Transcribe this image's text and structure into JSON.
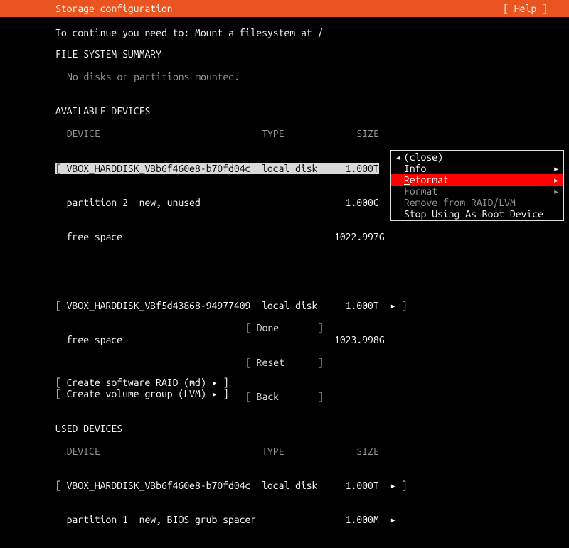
{
  "header": {
    "title": "Storage configuration",
    "help": "[ Help ]"
  },
  "instruction": "To continue you need to: Mount a filesystem at /",
  "fs_summary_title": "FILE SYSTEM SUMMARY",
  "fs_summary_empty": "No disks or partitions mounted.",
  "avail_title": "AVAILABLE DEVICES",
  "cols": {
    "device": "DEVICE",
    "type": "TYPE",
    "size": "SIZE"
  },
  "avail": {
    "d1": {
      "line": "[ VBOX_HARDDISK_VBb6f460e8-b70fd04c  local disk     1.000T",
      "p1": "  partition 2  new, unused                          1.000G",
      "fs": "  free space                                      1022.997G"
    },
    "d2": {
      "line": "[ VBOX_HARDDISK_VBf5d43868-94977409  local disk     1.000T  ▸ ]",
      "fs": "  free space                                      1023.998G"
    }
  },
  "actions": {
    "raid": "[ Create software RAID (md) ▸ ]",
    "lvm": "[ Create volume group (LVM) ▸ ]"
  },
  "used_title": "USED DEVICES",
  "used": {
    "d1": {
      "line": "[ VBOX_HARDDISK_VBb6f460e8-b70fd04c  local disk     1.000T  ▸ ]",
      "p1": "  partition 1  new, BIOS grub spacer                1.000M  ▸"
    }
  },
  "nav": {
    "done": "[ Done       ]",
    "reset": "[ Reset      ]",
    "back": "[ Back       ]"
  },
  "menu": {
    "close": "(close)",
    "info": "Info",
    "reformat_pre": "R",
    "reformat_post": "eformat",
    "format": "Format",
    "remove": "Remove from RAID/LVM",
    "stopboot": "Stop Using As Boot Device"
  }
}
